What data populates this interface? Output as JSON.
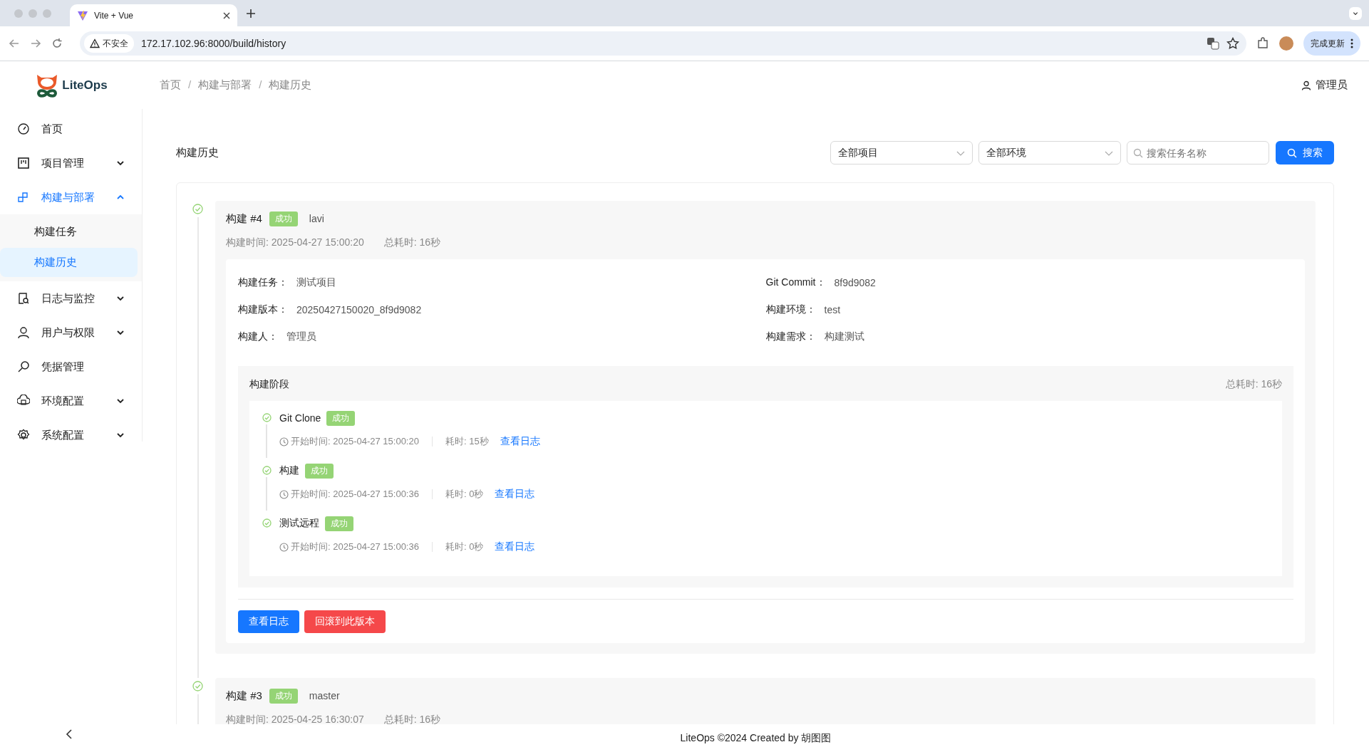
{
  "browser": {
    "tab_title": "Vite + Vue",
    "security_label": "不安全",
    "url": "172.17.102.96:8000/build/history",
    "update_button": "完成更新"
  },
  "sidebar": {
    "logo_text": "LiteOps",
    "items": [
      {
        "label": "首页",
        "kind": "link",
        "selected": false
      },
      {
        "label": "项目管理",
        "kind": "group",
        "selected": false,
        "expanded": false
      },
      {
        "label": "构建与部署",
        "kind": "group",
        "selected": true,
        "expanded": true,
        "children": [
          {
            "label": "构建任务",
            "selected": false
          },
          {
            "label": "构建历史",
            "selected": true
          }
        ]
      },
      {
        "label": "日志与监控",
        "kind": "group",
        "selected": false,
        "expanded": false
      },
      {
        "label": "用户与权限",
        "kind": "group",
        "selected": false,
        "expanded": false
      },
      {
        "label": "凭据管理",
        "kind": "link",
        "selected": false
      },
      {
        "label": "环境配置",
        "kind": "group",
        "selected": false,
        "expanded": false
      },
      {
        "label": "系统配置",
        "kind": "group",
        "selected": false,
        "expanded": false
      }
    ]
  },
  "header": {
    "breadcrumb": [
      "首页",
      "构建与部署",
      "构建历史"
    ],
    "breadcrumb_separator": "/",
    "user": "管理员"
  },
  "page": {
    "title": "构建历史",
    "project_select": "全部项目",
    "env_select": "全部环境",
    "search": {
      "placeholder": "搜索任务名称"
    },
    "search_button": "搜索"
  },
  "builds": [
    {
      "title": "构建 #4",
      "status": "成功",
      "branch": "lavi",
      "time": "构建时间: 2025-04-27 15:00:20",
      "duration": "总耗时: 16秒",
      "details": [
        {
          "label": "构建任务：",
          "value": "测试项目"
        },
        {
          "label": "Git Commit：",
          "value": "8f9d9082"
        },
        {
          "label": "构建版本：",
          "value": "20250427150020_8f9d9082"
        },
        {
          "label": "构建环境：",
          "value": "test"
        },
        {
          "label": "构建人：",
          "value": "管理员"
        },
        {
          "label": "构建需求：",
          "value": "构建测试"
        }
      ],
      "stages_title": "构建阶段",
      "stages_total": "总耗时: 16秒",
      "stages": [
        {
          "name": "Git Clone",
          "status": "成功",
          "start": "开始时间: 2025-04-27 15:00:20",
          "cost": "耗时: 15秒",
          "log_link": "查看日志"
        },
        {
          "name": "构建",
          "status": "成功",
          "start": "开始时间: 2025-04-27 15:00:36",
          "cost": "耗时: 0秒",
          "log_link": "查看日志"
        },
        {
          "name": "测试远程",
          "status": "成功",
          "start": "开始时间: 2025-04-27 15:00:36",
          "cost": "耗时: 0秒",
          "log_link": "查看日志"
        }
      ],
      "actions": [
        {
          "label": "查看日志",
          "kind": "primary"
        },
        {
          "label": "回滚到此版本",
          "kind": "danger"
        }
      ]
    },
    {
      "title": "构建 #3",
      "status": "成功",
      "branch": "master",
      "time": "构建时间: 2025-04-25 16:30:07",
      "duration": "总耗时: 16秒"
    }
  ],
  "footer": "LiteOps ©2024 Created by 胡图图"
}
